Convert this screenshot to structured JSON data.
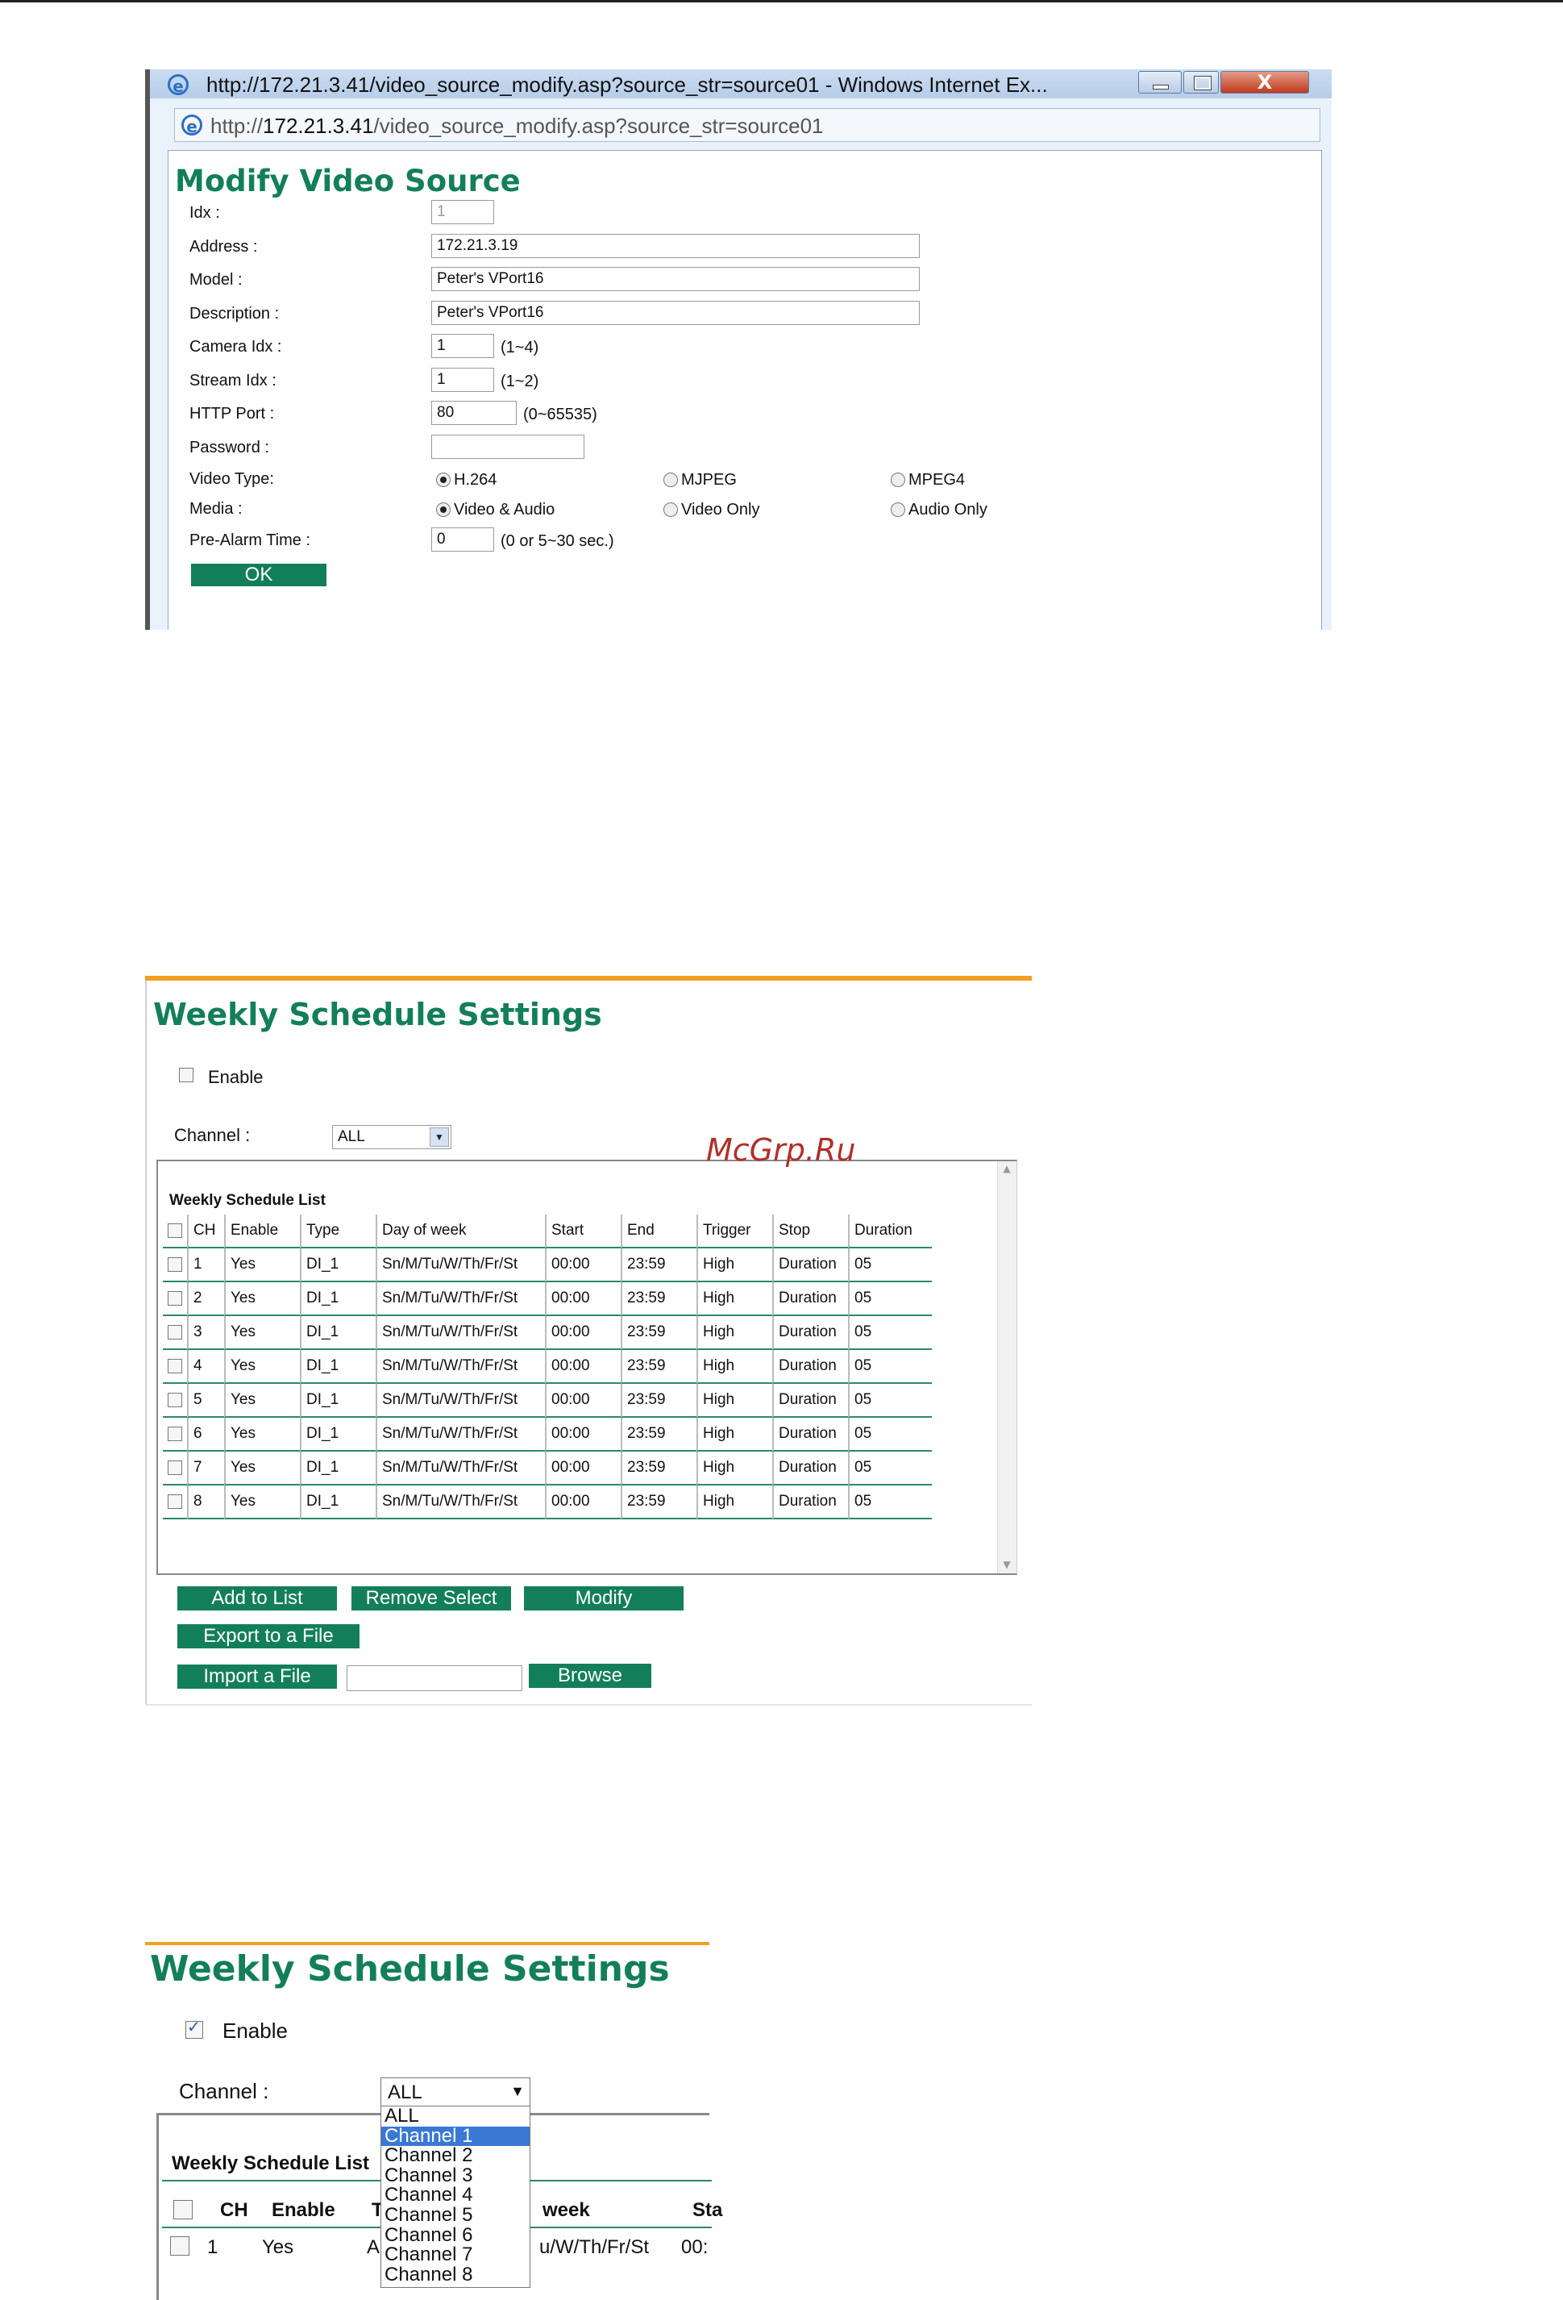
{
  "popup": {
    "window_title": "http://172.21.3.41/video_source_modify.asp?source_str=source01 - Windows Internet Ex...",
    "close_glyph": "X",
    "address_prefix": "http://",
    "address_host": "172.21.3.41",
    "address_path": "/video_source_modify.asp?source_str=source01",
    "heading": "Modify Video Source",
    "fields": {
      "idx_label": "Idx :",
      "idx_value": "1",
      "address_label": "Address :",
      "address_value": "172.21.3.19",
      "model_label": "Model :",
      "model_value": "Peter's VPort16",
      "description_label": "Description :",
      "description_value": "Peter's VPort16",
      "camera_idx_label": "Camera Idx :",
      "camera_idx_value": "1",
      "camera_idx_hint": "(1~4)",
      "stream_idx_label": "Stream Idx :",
      "stream_idx_value": "1",
      "stream_idx_hint": "(1~2)",
      "http_port_label": "HTTP Port :",
      "http_port_value": "80",
      "http_port_hint": "(0~65535)",
      "password_label": "Password :",
      "password_value": "",
      "video_type_label": "Video Type:",
      "video_type_options": [
        "H.264",
        "MJPEG",
        "MPEG4"
      ],
      "video_type_selected": "H.264",
      "media_label": "Media :",
      "media_options": [
        "Video & Audio",
        "Video Only",
        "Audio Only"
      ],
      "media_selected": "Video & Audio",
      "pre_alarm_label": "Pre-Alarm Time :",
      "pre_alarm_value": "0",
      "pre_alarm_hint": "(0 or 5~30 sec.)"
    },
    "ok_label": "OK"
  },
  "watermark": "McGrp.Ru",
  "schedule1": {
    "title": "Weekly Schedule Settings",
    "enable_label": "Enable",
    "enable_checked": false,
    "channel_label": "Channel :",
    "channel_value": "ALL",
    "list_title": "Weekly Schedule List",
    "columns": [
      "CH",
      "Enable",
      "Type",
      "Day of week",
      "Start",
      "End",
      "Trigger",
      "Stop",
      "Duration"
    ],
    "rows": [
      [
        "1",
        "Yes",
        "DI_1",
        "Sn/M/Tu/W/Th/Fr/St",
        "00:00",
        "23:59",
        "High",
        "Duration",
        "05"
      ],
      [
        "2",
        "Yes",
        "DI_1",
        "Sn/M/Tu/W/Th/Fr/St",
        "00:00",
        "23:59",
        "High",
        "Duration",
        "05"
      ],
      [
        "3",
        "Yes",
        "DI_1",
        "Sn/M/Tu/W/Th/Fr/St",
        "00:00",
        "23:59",
        "High",
        "Duration",
        "05"
      ],
      [
        "4",
        "Yes",
        "DI_1",
        "Sn/M/Tu/W/Th/Fr/St",
        "00:00",
        "23:59",
        "High",
        "Duration",
        "05"
      ],
      [
        "5",
        "Yes",
        "DI_1",
        "Sn/M/Tu/W/Th/Fr/St",
        "00:00",
        "23:59",
        "High",
        "Duration",
        "05"
      ],
      [
        "6",
        "Yes",
        "DI_1",
        "Sn/M/Tu/W/Th/Fr/St",
        "00:00",
        "23:59",
        "High",
        "Duration",
        "05"
      ],
      [
        "7",
        "Yes",
        "DI_1",
        "Sn/M/Tu/W/Th/Fr/St",
        "00:00",
        "23:59",
        "High",
        "Duration",
        "05"
      ],
      [
        "8",
        "Yes",
        "DI_1",
        "Sn/M/Tu/W/Th/Fr/St",
        "00:00",
        "23:59",
        "High",
        "Duration",
        "05"
      ]
    ],
    "buttons": {
      "add": "Add to List",
      "remove": "Remove Select",
      "modify": "Modify",
      "export": "Export to a File",
      "import": "Import a File",
      "browse": "Browse"
    }
  },
  "schedule2": {
    "title": "Weekly Schedule Settings",
    "enable_label": "Enable",
    "enable_checked": true,
    "channel_label": "Channel :",
    "channel_value": "ALL",
    "list_title": "Weekly Schedule List",
    "columns_visible": [
      "CH",
      "Enable",
      "T",
      "week",
      "Sta"
    ],
    "row_visible": [
      "1",
      "Yes",
      "Al",
      "u/W/Th/Fr/St",
      "00:"
    ],
    "dropdown_options": [
      "ALL",
      "Channel 1",
      "Channel 2",
      "Channel 3",
      "Channel 4",
      "Channel 5",
      "Channel 6",
      "Channel 7",
      "Channel 8"
    ],
    "dropdown_highlighted": "Channel 1"
  },
  "colors": {
    "accent_green": "#137f5a",
    "orange_bar": "#f0a020",
    "highlight_blue": "#3a78d4"
  }
}
